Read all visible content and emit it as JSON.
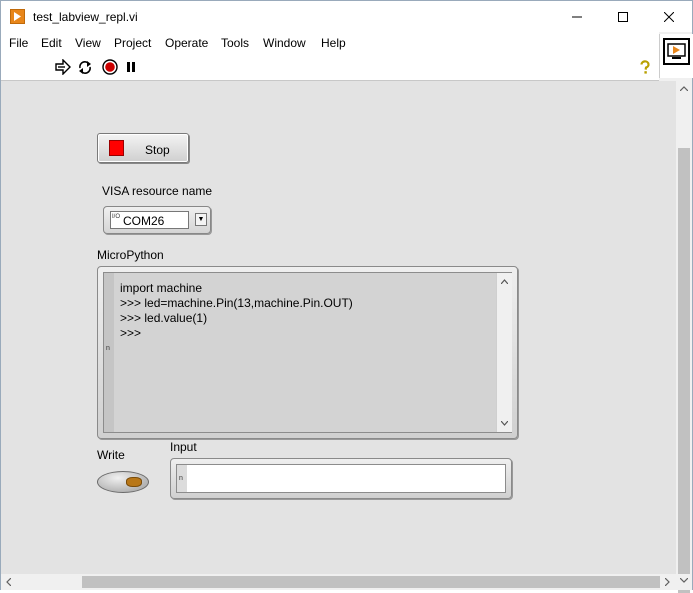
{
  "window": {
    "title": "test_labview_repl.vi"
  },
  "menu": [
    "File",
    "Edit",
    "View",
    "Project",
    "Operate",
    "Tools",
    "Window",
    "Help"
  ],
  "toolbar": {
    "icons": [
      "run-arrow-icon",
      "run-continuously-icon",
      "abort-icon",
      "pause-icon",
      "help-icon"
    ]
  },
  "panel": {
    "stop_button": {
      "label": "Stop",
      "led_color": "#ff0000"
    },
    "visa": {
      "label": "VISA resource name",
      "value": "COM26",
      "io_marker": "I/O"
    },
    "micropython": {
      "label": "MicroPython",
      "lines": [
        "import machine",
        ">>> led=machine.Pin(13,machine.Pin.OUT)",
        ">>> led.value(1)",
        ">>>"
      ],
      "gutter_marker": "n"
    },
    "write": {
      "label": "Write",
      "led_color": "#b87718"
    },
    "input": {
      "label": "Input",
      "value": "",
      "gutter_marker": "n"
    }
  },
  "colors": {
    "panel_bg": "#e3e3e3",
    "app_icon": "#e8861a"
  }
}
